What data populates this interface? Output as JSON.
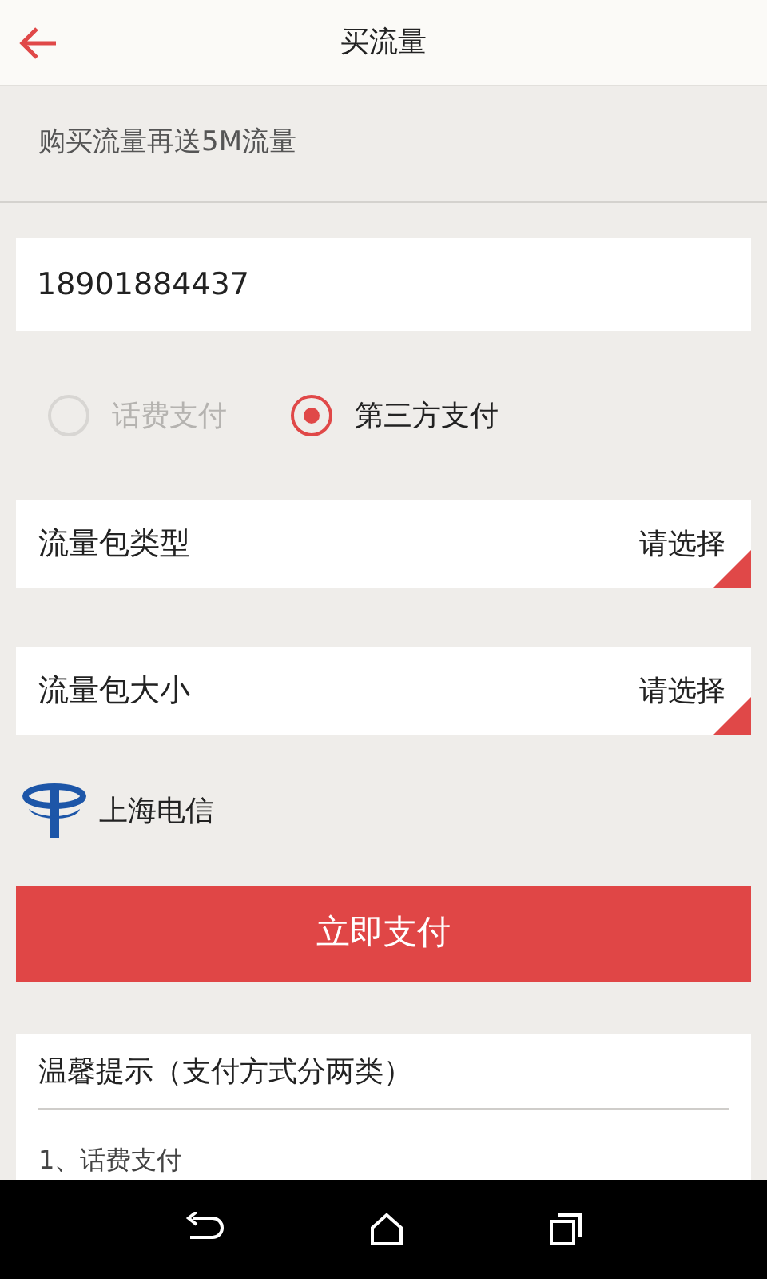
{
  "header": {
    "title": "买流量"
  },
  "promo": "购买流量再送5M流量",
  "phone": {
    "value": "18901884437"
  },
  "payment_options": [
    {
      "label": "话费支付",
      "selected": false,
      "disabled": true
    },
    {
      "label": "第三方支付",
      "selected": true,
      "disabled": false
    }
  ],
  "selects": [
    {
      "label": "流量包类型",
      "value": "请选择"
    },
    {
      "label": "流量包大小",
      "value": "请选择"
    }
  ],
  "carrier": "上海电信",
  "pay_button": "立即支付",
  "tips": {
    "title": "温馨提示（支付方式分两类）",
    "items": [
      "1、话费支付"
    ]
  }
}
